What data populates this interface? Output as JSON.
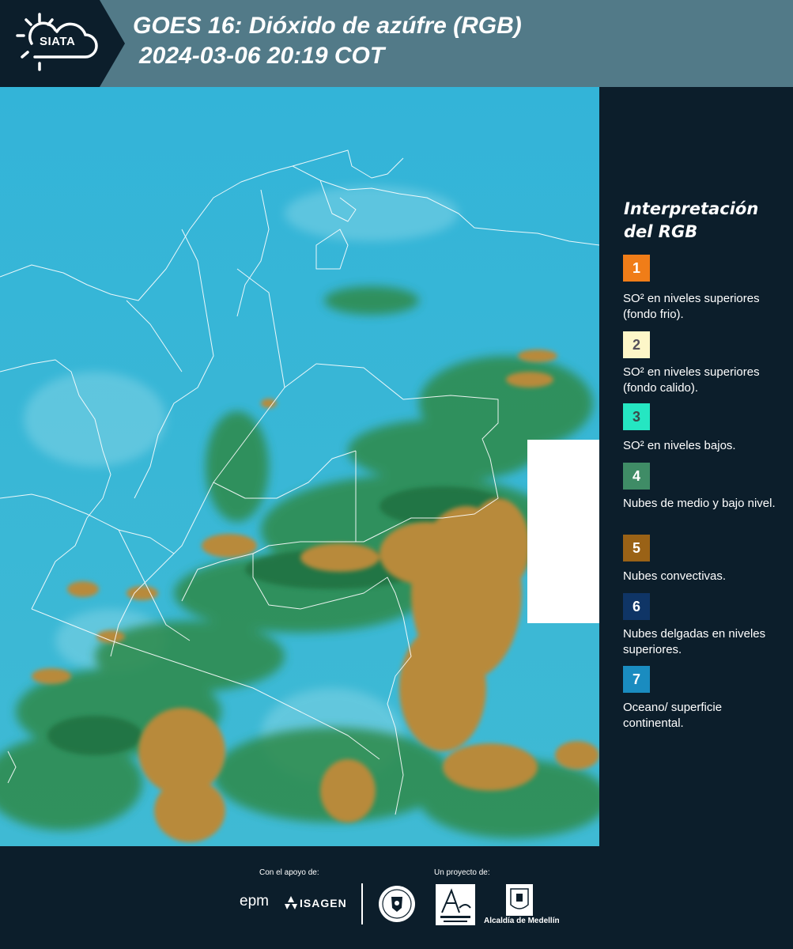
{
  "header": {
    "logo_text": "SIATA",
    "title_line1": "GOES 16: Dióxido de azúfre (RGB)",
    "title_line2": "2024-03-06 20:19 COT"
  },
  "legend": {
    "title": "Interpretación del RGB",
    "items": [
      {
        "number": "1",
        "label": "SO² en niveles superiores (fondo frio).",
        "color": "#f07d18",
        "text_color": "#ffffff"
      },
      {
        "number": "2",
        "label": "SO² en niveles superiores (fondo calido).",
        "color": "#fdf6c8",
        "text_color": "#55505a"
      },
      {
        "number": "3",
        "label": "SO² en niveles bajos.",
        "color": "#25e6c2",
        "text_color": "#3a4a4a"
      },
      {
        "number": "4",
        "label": "Nubes de medio y bajo nivel.",
        "color": "#3f8c66",
        "text_color": "#ffffff"
      },
      {
        "number": "5",
        "label": "Nubes convectivas.",
        "color": "#9a6216",
        "text_color": "#ffffff"
      },
      {
        "number": "6",
        "label": "Nubes delgadas en niveles superiores.",
        "color": "#0f3566",
        "text_color": "#ffffff"
      },
      {
        "number": "7",
        "label": "Oceano/ superficie continental.",
        "color": "#1a8cc0",
        "text_color": "#ffffff"
      }
    ]
  },
  "footer": {
    "support_label": "Con el apoyo de:",
    "project_label": "Un proyecto de:",
    "sponsor1": "epm",
    "sponsor2": "ISAGEN",
    "partner_medellin": "Alcaldía de Medellín"
  },
  "colors": {
    "header_bg": "#527a88",
    "panel_bg": "#0c1e2b",
    "ocean": "#37b6d6",
    "cloud_green": "#2f7d45",
    "convective": "#b98a3c"
  }
}
